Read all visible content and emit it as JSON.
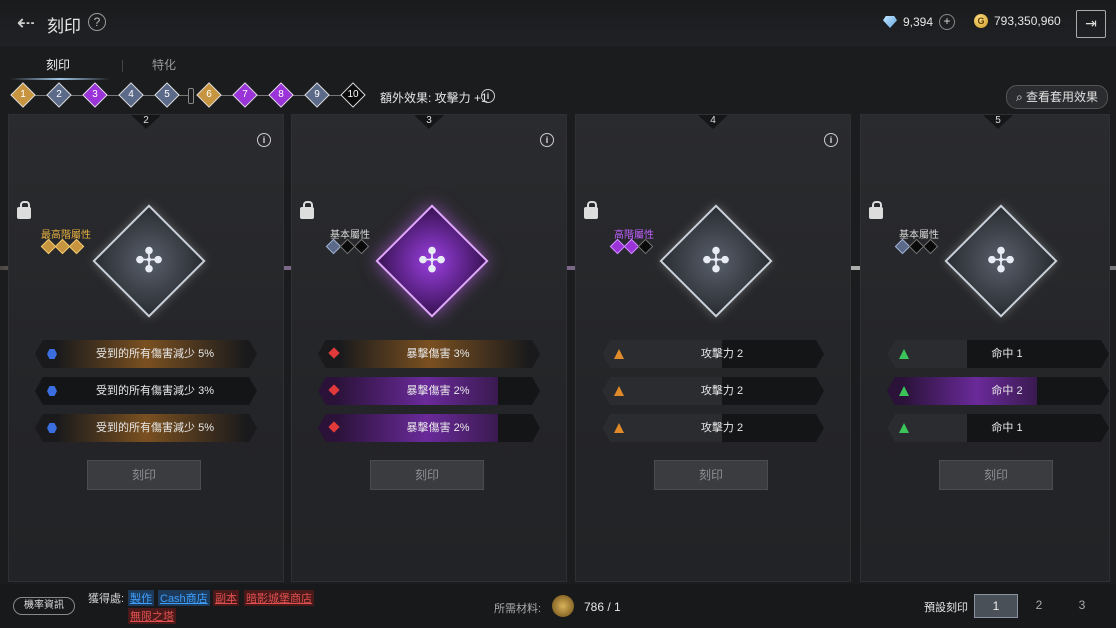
{
  "header": {
    "title": "刻印",
    "help_icon": "question-circle-icon",
    "diamonds": "9,394",
    "gold": "793,350,960",
    "gold_symbol": "G"
  },
  "tabs": [
    "刻印",
    "特化"
  ],
  "steps": [
    "1",
    "2",
    "3",
    "4",
    "5",
    "6",
    "7",
    "8",
    "9",
    "10"
  ],
  "bonus": "額外效果: 攻擊力 +1",
  "view_button": "查看套用效果",
  "panels": [
    {
      "num": "2",
      "attr_label": "最高階屬性",
      "attr_color": "#e6b040",
      "options": [
        "受到的所有傷害減少 5%",
        "受到的所有傷害減少 3%",
        "受到的所有傷害減少 5%"
      ],
      "engrave": "刻印"
    },
    {
      "num": "3",
      "attr_label": "基本屬性",
      "attr_color": "#d8d8d8",
      "options": [
        "暴擊傷害 3%",
        "暴擊傷害 2%",
        "暴擊傷害 2%"
      ],
      "engrave": "刻印"
    },
    {
      "num": "4",
      "attr_label": "高階屬性",
      "attr_color": "#c060ff",
      "options": [
        "攻擊力 2",
        "攻擊力 2",
        "攻擊力 2"
      ],
      "engrave": "刻印"
    },
    {
      "num": "5",
      "attr_label": "基本屬性",
      "attr_color": "#d8d8d8",
      "options": [
        "命中 1",
        "命中 2",
        "命中 1"
      ],
      "engrave": "刻印"
    }
  ],
  "bottom": {
    "prob_button": "機率資訊",
    "source_label": "獲得處:",
    "sources": [
      "製作",
      "Cash商店",
      "副本",
      "暗影城堡商店",
      "無限之塔"
    ],
    "need_label": "所需材料:",
    "need_value": "786 / 1",
    "preset_label": "預設刻印",
    "presets": [
      "1",
      "2",
      "3"
    ]
  }
}
